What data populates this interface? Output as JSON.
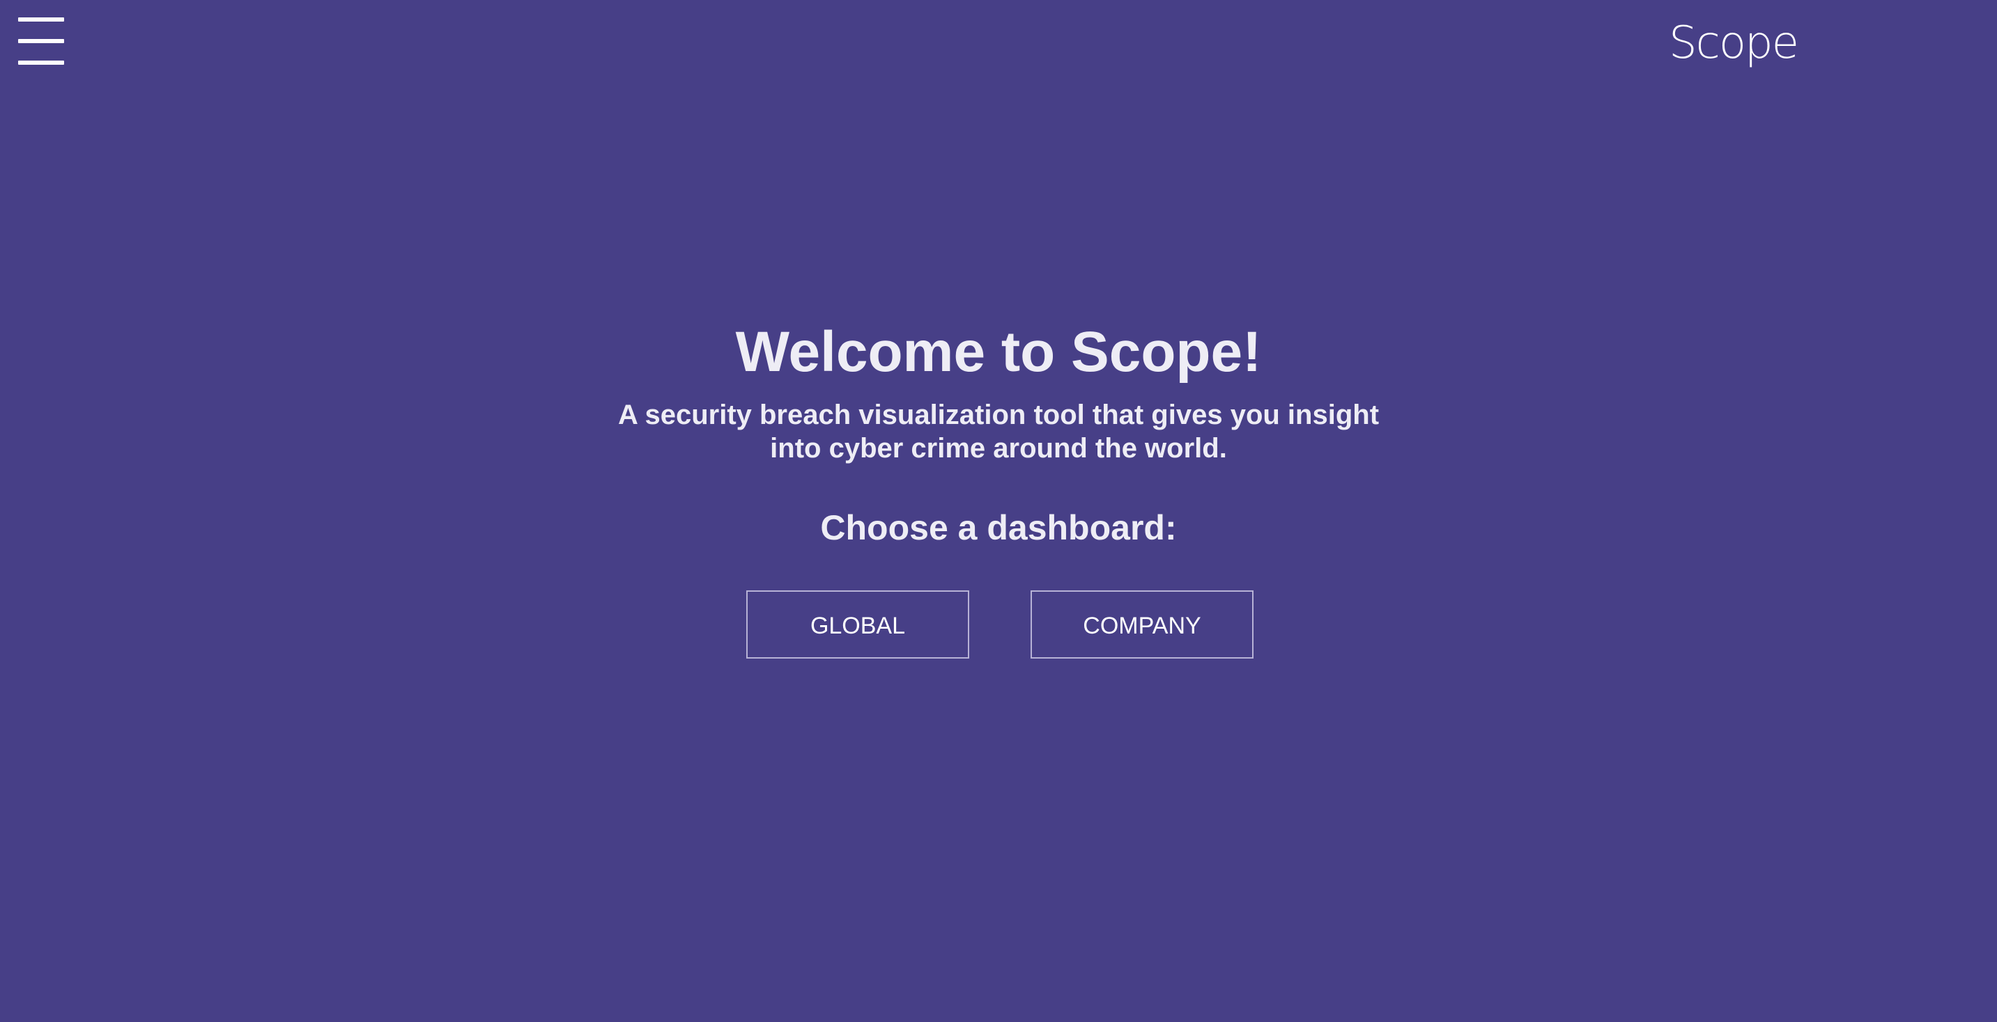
{
  "header": {
    "menu_icon": "hamburger-menu-icon",
    "logo_text": "Scope"
  },
  "hero": {
    "title": "Welcome to Scope!",
    "subtitle_line1": "A security breach visualization tool that gives you insight",
    "subtitle_line2": "into cyber crime around the world.",
    "choose_label": "Choose a dashboard:"
  },
  "dashboards": {
    "global_label": "GLOBAL",
    "company_label": "COMPANY"
  },
  "colors": {
    "background": "#473f87",
    "text": "#eeedf5",
    "button_border": "#b7b2d6"
  }
}
